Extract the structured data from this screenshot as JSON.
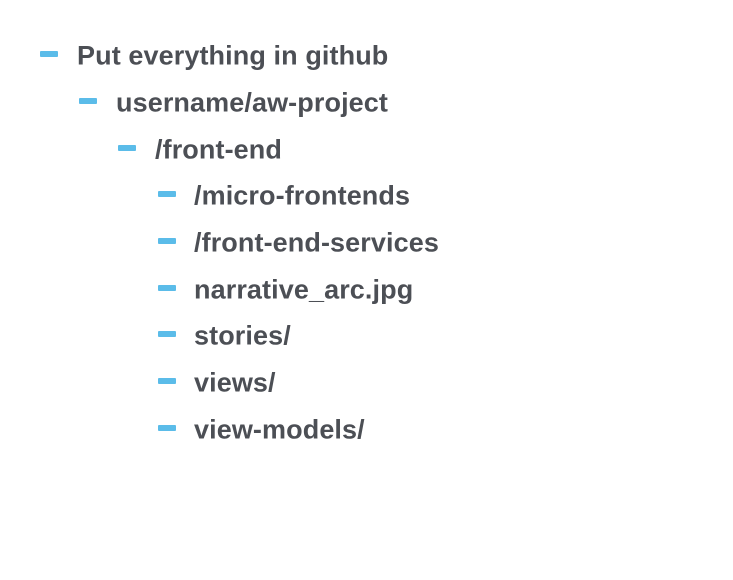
{
  "colors": {
    "bullet": "#5bbce9",
    "text": "#4c4f55",
    "background": "#ffffff"
  },
  "outline": {
    "items": [
      {
        "label": "Put everything in github",
        "level": 1
      },
      {
        "label": "username/aw-project",
        "level": 2
      },
      {
        "label": "/front-end",
        "level": 3
      },
      {
        "label": "/micro-frontends",
        "level": 4
      },
      {
        "label": "/front-end-services",
        "level": 4
      },
      {
        "label": "narrative_arc.jpg",
        "level": 4
      },
      {
        "label": "stories/",
        "level": 4
      },
      {
        "label": "views/",
        "level": 4
      },
      {
        "label": "view-models/",
        "level": 4
      }
    ]
  }
}
